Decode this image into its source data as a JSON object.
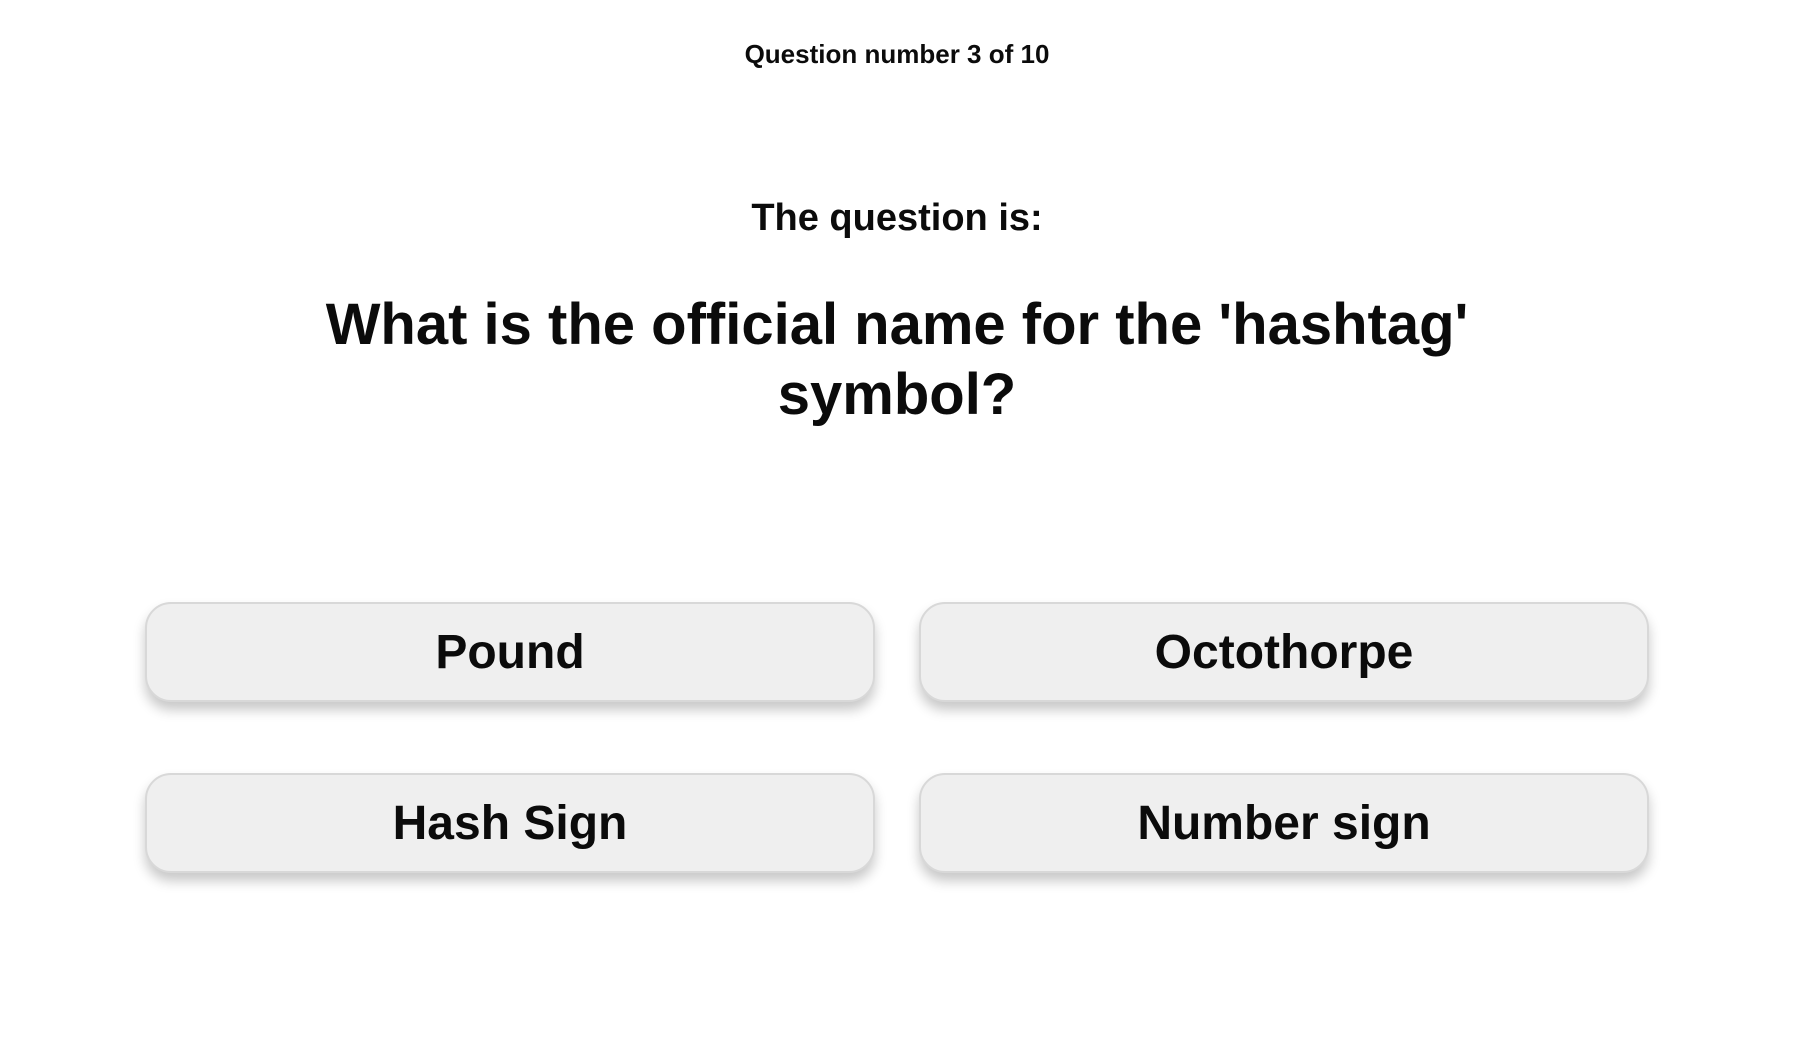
{
  "quiz": {
    "progress_text": "Question number 3 of 10",
    "prompt_text": "The question is:",
    "question_text": "What is the official name for the 'hashtag' symbol?",
    "answers": [
      {
        "label": "Pound"
      },
      {
        "label": "Octothorpe"
      },
      {
        "label": "Hash Sign"
      },
      {
        "label": "Number sign"
      }
    ]
  }
}
